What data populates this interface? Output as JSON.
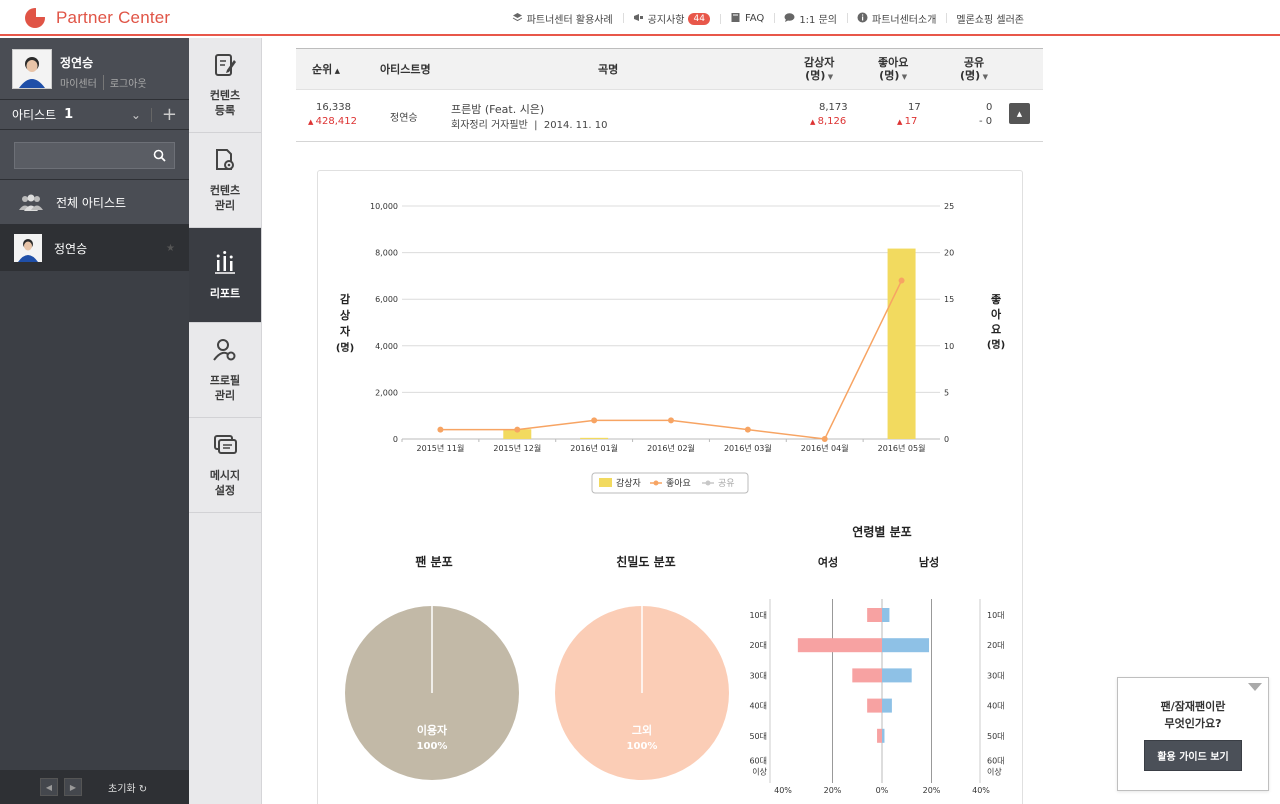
{
  "header": {
    "logo_text": "Partner Center",
    "nav": [
      {
        "label": "파트너센터 활용사례",
        "icon": "layers-icon"
      },
      {
        "label": "공지사항",
        "icon": "megaphone-icon",
        "badge": "44"
      },
      {
        "label": "FAQ",
        "icon": "book-icon"
      },
      {
        "label": "1:1 문의",
        "icon": "chat-icon"
      },
      {
        "label": "파트너센터소개",
        "icon": "info-icon"
      },
      {
        "label": "멜론쇼핑 셀러존",
        "icon": ""
      }
    ],
    "accent": "#e8574a"
  },
  "sidebar": {
    "user_name": "정연승",
    "my_center": "마이센터",
    "logout": "로그아웃",
    "artist_label": "아티스트",
    "artist_count": "1",
    "search_placeholder": "",
    "all_artists": "전체 아티스트",
    "artists": [
      {
        "name": "정연승"
      }
    ],
    "reset": "초기화"
  },
  "menu": [
    {
      "label": "컨텐츠\n등록",
      "icon": "edit-document-icon",
      "active": false
    },
    {
      "label": "컨텐츠\n관리",
      "icon": "document-gear-icon",
      "active": false
    },
    {
      "label": "리포트",
      "icon": "bar-chart-icon",
      "active": true
    },
    {
      "label": "프로필\n관리",
      "icon": "user-gear-icon",
      "active": false
    },
    {
      "label": "메시지\n설정",
      "icon": "message-icon",
      "active": false
    }
  ],
  "table": {
    "headers": {
      "rank": "순위",
      "artist": "아티스트명",
      "song": "곡명",
      "listeners": "감상자",
      "listeners_unit": "(명)",
      "likes": "좋아요",
      "likes_unit": "(명)",
      "shares": "공유",
      "shares_unit": "(명)"
    },
    "row": {
      "rank": "16,338",
      "rank_change": "428,412",
      "artist": "정연승",
      "song_title": "프른밤 (Feat. 시은)",
      "album": "회자정리 거자필반",
      "date": "2014. 11. 10",
      "listeners": "8,173",
      "listeners_change": "8,126",
      "likes": "17",
      "likes_change": "17",
      "shares": "0",
      "shares_change": "- 0"
    }
  },
  "help": {
    "question_line1": "팬/잠재팬이란",
    "question_line2": "무엇인가요?",
    "button": "활용 가이드 보기"
  },
  "chart_data": [
    {
      "type": "bar",
      "categories": [
        "2015년 11월",
        "2015년 12월",
        "2016년 01월",
        "2016년 02월",
        "2016년 03월",
        "2016년 04월",
        "2016년 05월"
      ],
      "series": [
        {
          "name": "감상자",
          "values": [
            0,
            420,
            50,
            0,
            0,
            0,
            8173
          ],
          "color": "#f2da5f",
          "kind": "bar",
          "axis": "left"
        },
        {
          "name": "좋아요",
          "values": [
            1,
            1,
            2,
            2,
            1,
            0,
            17
          ],
          "color": "#f7a463",
          "kind": "line",
          "axis": "right"
        },
        {
          "name": "공유",
          "values": [
            0,
            0,
            0,
            0,
            0,
            0,
            0
          ],
          "color": "#c8c8c8",
          "kind": "line",
          "axis": "right",
          "hidden": true
        }
      ],
      "ylabel": "감상자\n(명)",
      "y2label": "좋아요\n(명)",
      "ylim": [
        0,
        10000
      ],
      "yticks": [
        "0",
        "2,000",
        "4,000",
        "6,000",
        "8,000",
        "10,000"
      ],
      "y2lim": [
        0,
        25
      ],
      "y2ticks": [
        "0",
        "5",
        "10",
        "15",
        "20",
        "25"
      ],
      "grid": true,
      "legend": "bottom"
    },
    {
      "type": "pie",
      "title": "팬 분포",
      "slices": [
        {
          "label": "이용자",
          "value": 100,
          "display": "100%",
          "color": "#c2b9a7"
        }
      ]
    },
    {
      "type": "pie",
      "title": "친밀도 분포",
      "slices": [
        {
          "label": "그외",
          "value": 100,
          "display": "100%",
          "color": "#fbcdb6"
        }
      ]
    },
    {
      "type": "bar",
      "title": "연령별 분포",
      "left_label": "여성",
      "right_label": "남성",
      "categories": [
        "10대",
        "20대",
        "30대",
        "40대",
        "50대",
        "60대\n이상"
      ],
      "series": [
        {
          "name": "여성",
          "values": [
            6,
            34,
            12,
            6,
            2,
            0
          ],
          "color": "#f7a2a2"
        },
        {
          "name": "남성",
          "values": [
            3,
            19,
            12,
            4,
            1,
            0
          ],
          "color": "#8ec1e6"
        }
      ],
      "xticks": [
        "40%",
        "20%",
        "0%",
        "20%",
        "40%"
      ],
      "xlim": [
        -40,
        40
      ]
    }
  ]
}
